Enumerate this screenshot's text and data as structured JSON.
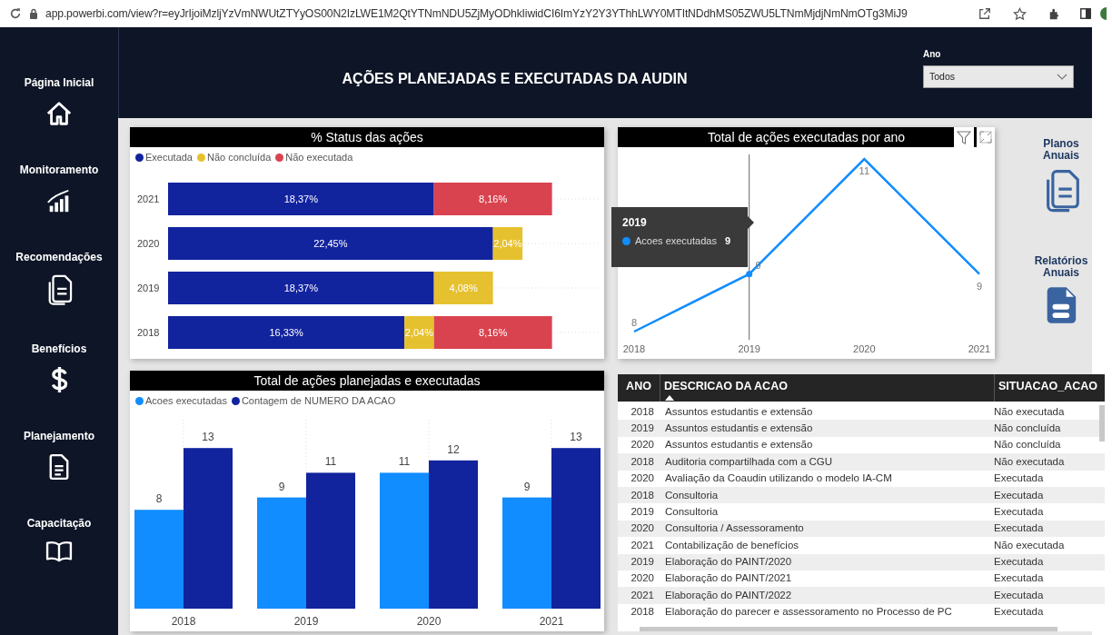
{
  "browser": {
    "url": "app.powerbi.com/view?r=eyJrIjoiMzljYzVmNWUtZTYyOS00N2IzLWE1M2QtYTNmNDU5ZjMyODhkIiwidCI6ImYzY2Y3YThhLWY0MTItNDdhMS05ZWU5LTNmMjdjNmNmOTg3MiJ9"
  },
  "sidebar": {
    "items": [
      {
        "label": "Página Inicial",
        "kind": "home"
      },
      {
        "label": "Monitoramento",
        "kind": "chart"
      },
      {
        "label": "Recomendações",
        "kind": "documents"
      },
      {
        "label": "Benefícios",
        "kind": "money"
      },
      {
        "label": "Planejamento",
        "kind": "document"
      },
      {
        "label": "Capacitação",
        "kind": "book"
      }
    ]
  },
  "header": {
    "title": "AÇÕES PLANEJADAS E EXECUTADAS DA AUDIN",
    "slicer": {
      "label": "Ano",
      "value": "Todos"
    }
  },
  "status_chart": {
    "title": "% Status das ações",
    "chart_data": {
      "type": "bar",
      "orientation": "horizontal",
      "stacked": true,
      "categories": [
        "2021",
        "2020",
        "2019",
        "2018"
      ],
      "data_labels": true,
      "series": [
        {
          "name": "Executada",
          "color": "#12239e",
          "values": [
            18.37,
            22.45,
            18.37,
            16.33
          ],
          "value_labels": [
            "18,37%",
            "22,45%",
            "18,37%",
            "16,33%"
          ]
        },
        {
          "name": "Não concluída",
          "color": "#e6c12f",
          "values": [
            null,
            2.04,
            4.08,
            2.04
          ],
          "value_labels": [
            null,
            "2,04%",
            "4,08%",
            "2,04%"
          ]
        },
        {
          "name": "Não executada",
          "color": "#d9434f",
          "values": [
            8.16,
            null,
            null,
            8.16
          ],
          "value_labels": [
            "8,16%",
            null,
            null,
            "8,16%"
          ]
        }
      ]
    }
  },
  "line_chart": {
    "title": "Total de ações executadas por ano",
    "chart_data": {
      "type": "line",
      "x": [
        2018,
        2019,
        2020,
        2021
      ],
      "xlim": [
        2018,
        2021
      ],
      "xticks": [
        2018,
        2019,
        2020,
        2021
      ],
      "data_labels": true,
      "ref_lines": [
        {
          "axis": "x",
          "value": 2019
        }
      ],
      "series": [
        {
          "name": "Acoes executadas",
          "color": "#118dff",
          "values": [
            8,
            9,
            11,
            9
          ]
        }
      ]
    },
    "tooltip": {
      "title": "2019",
      "value": "9"
    }
  },
  "links": [
    {
      "label": "Planos Anuais",
      "kind": "documents"
    },
    {
      "label": "Relatórios Anuais",
      "kind": "file"
    }
  ],
  "bar_chart": {
    "title": "Total de ações planejadas e executadas",
    "chart_data": {
      "type": "bar",
      "categories": [
        "2018",
        "2019",
        "2020",
        "2021"
      ],
      "grid": true,
      "data_labels": true,
      "series": [
        {
          "name": "Acoes executadas",
          "color": "#118dff",
          "values": [
            8,
            9,
            11,
            9
          ]
        },
        {
          "name": "Contagem de NUMERO DA ACAO",
          "color": "#12239e",
          "values": [
            13,
            11,
            12,
            13
          ]
        }
      ]
    }
  },
  "table": {
    "columns": [
      {
        "label": "ANO",
        "sorted": false
      },
      {
        "label": "DESCRICAO DA ACAO",
        "sorted": true
      },
      {
        "label": "SITUACAO_ACAO",
        "sorted": false
      }
    ],
    "rows": [
      [
        "2018",
        "Assuntos estudantis e extensão",
        "Não executada"
      ],
      [
        "2019",
        "Assuntos estudantis e extensão",
        "Não concluída"
      ],
      [
        "2020",
        "Assuntos estudantis e extensão",
        "Não concluída"
      ],
      [
        "2018",
        "Auditoria compartilhada com a CGU",
        "Não executada"
      ],
      [
        "2020",
        "Avaliação da Coaudin utilizando o modelo IA-CM",
        "Executada"
      ],
      [
        "2018",
        "Consultoria",
        "Executada"
      ],
      [
        "2019",
        "Consultoria",
        "Executada"
      ],
      [
        "2020",
        "Consultoria / Assessoramento",
        "Executada"
      ],
      [
        "2021",
        "Contabilização de benefícios",
        "Não executada"
      ],
      [
        "2019",
        "Elaboração do PAINT/2020",
        "Executada"
      ],
      [
        "2020",
        "Elaboração do PAINT/2021",
        "Executada"
      ],
      [
        "2021",
        "Elaboração do PAINT/2022",
        "Executada"
      ],
      [
        "2018",
        "Elaboração do parecer e assessoramento no Processo de PC",
        "Executada"
      ]
    ]
  }
}
